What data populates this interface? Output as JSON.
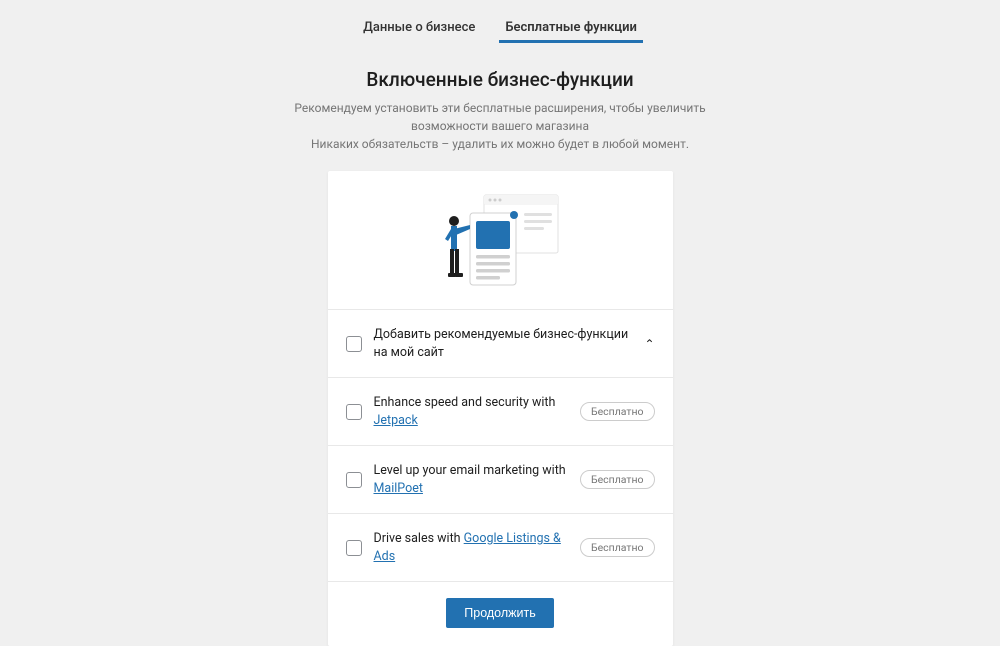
{
  "tabs": [
    {
      "label": "Данные о бизнесе",
      "active": false
    },
    {
      "label": "Бесплатные функции",
      "active": true
    }
  ],
  "header": {
    "title": "Включенные бизнес-функции",
    "subtitle1": "Рекомендуем установить эти бесплатные расширения, чтобы увеличить",
    "subtitle2": "возможности вашего магазина",
    "subtitle3": "Никаких обязательств – удалить их можно будет в любой момент."
  },
  "options": {
    "main": {
      "text": "Добавить рекомендуемые бизнес-функции на мой сайт"
    },
    "jetpack": {
      "prefix": "Enhance speed and security with ",
      "link": "Jetpack",
      "badge": "Бесплатно"
    },
    "mailpoet": {
      "prefix": "Level up your email marketing with ",
      "link": "MailPoet",
      "badge": "Бесплатно"
    },
    "google": {
      "prefix": "Drive sales with ",
      "link": "Google Listings & Ads",
      "badge": "Бесплатно"
    }
  },
  "footer": {
    "continue": "Продолжить"
  }
}
